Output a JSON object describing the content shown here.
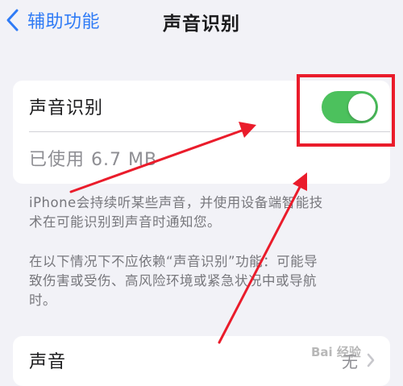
{
  "nav": {
    "back_label": "辅助功能",
    "title": "声音识别"
  },
  "main": {
    "toggle_row_label": "声音识别",
    "toggle_state": "on",
    "usage_label": "已使用 6.7 MB",
    "description_1_line1": "iPhone会持续听某些声音，并使用设备端智能技",
    "description_1_line2": "术在可能识别到声音时通知您。",
    "description_2_line1": "在以下情况下不应依赖“声音识别”功能：可能导",
    "description_2_line2": "致伤害或受伤、高风险环境或紧急状况中或导航",
    "description_2_line3": "时。",
    "sounds_row_label": "声音",
    "sounds_row_value": "无"
  },
  "watermark": "Bai 经验",
  "colors": {
    "accent": "#2f7bf6",
    "toggle_on": "#4cc15d",
    "annotation": "#ea1c2b",
    "background": "#f2f2f7"
  }
}
